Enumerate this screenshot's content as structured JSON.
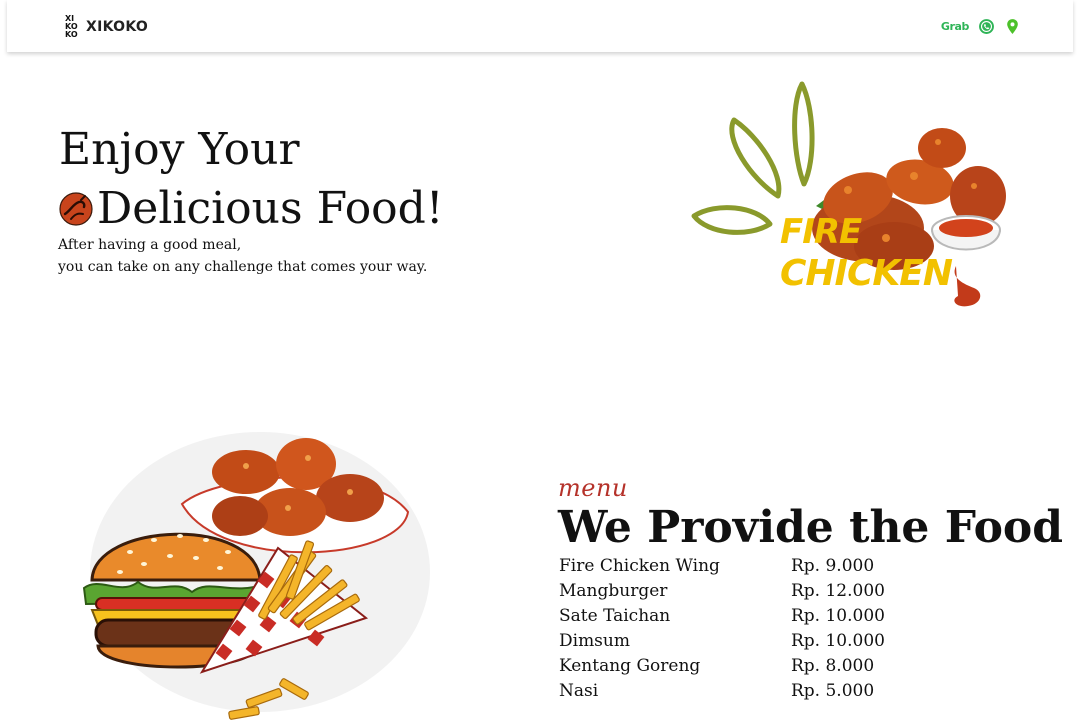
{
  "header": {
    "brand_mark": [
      "XI",
      "KO",
      "KO"
    ],
    "brand_name": "XIKOKO",
    "grab_label": "Grab",
    "icons": [
      "whatsapp-icon",
      "location-pin-icon"
    ],
    "colors": {
      "grab": "#2fb457",
      "whatsapp": "#2fb457",
      "location": "#4cc12a"
    }
  },
  "hero": {
    "title_line1": "Enjoy Your",
    "title_line2": "Delicious Food!",
    "subtitle_line1": "After having a good meal,",
    "subtitle_line2": "you can take on any challenge that comes your way.",
    "art_word1": "FIRE",
    "art_word2": "CHICKEN",
    "colors": {
      "art_text": "#f2c100",
      "leaf": "#8a9a2c",
      "chicken": "#c8541b"
    }
  },
  "menu": {
    "eyebrow": "menu",
    "title": "We Provide the Food",
    "items": [
      {
        "name": "Fire Chicken Wing",
        "price": "Rp. 9.000"
      },
      {
        "name": "Mangburger",
        "price": "Rp. 12.000"
      },
      {
        "name": "Sate Taichan",
        "price": "Rp. 10.000"
      },
      {
        "name": "Dimsum",
        "price": "Rp. 10.000"
      },
      {
        "name": "Kentang Goreng",
        "price": "Rp. 8.000"
      },
      {
        "name": "Nasi",
        "price": "Rp. 5.000"
      }
    ],
    "colors": {
      "eyebrow": "#b5322a"
    }
  }
}
